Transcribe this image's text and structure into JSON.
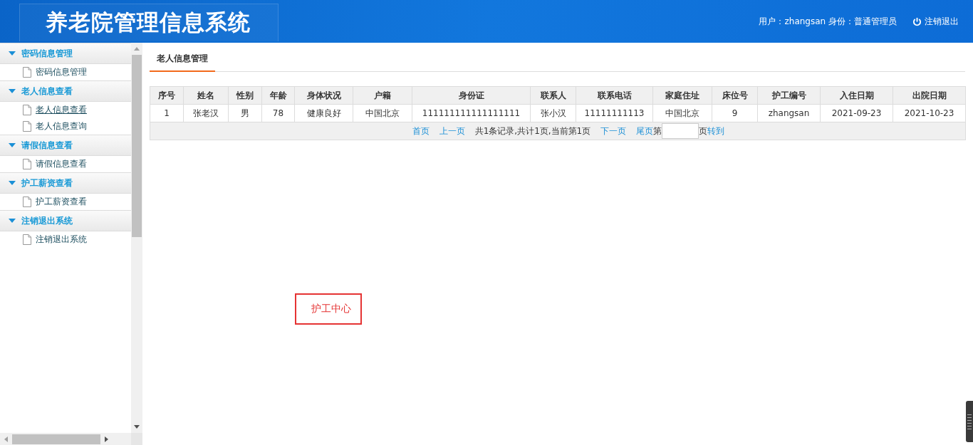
{
  "header": {
    "title": "养老院管理信息系统",
    "user_info": "用户：zhangsan 身份：普通管理员",
    "logout": "注销退出"
  },
  "sidebar": {
    "groups": [
      {
        "label": "密码信息管理",
        "expanded": true,
        "items": [
          {
            "label": "密码信息管理",
            "selected": false
          }
        ]
      },
      {
        "label": "老人信息查看",
        "expanded": true,
        "items": [
          {
            "label": "老人信息查看",
            "selected": true
          },
          {
            "label": "老人信息查询",
            "selected": false
          }
        ]
      },
      {
        "label": "请假信息查看",
        "expanded": true,
        "items": [
          {
            "label": "请假信息查看",
            "selected": false
          }
        ]
      },
      {
        "label": "护工薪资查看",
        "expanded": true,
        "items": [
          {
            "label": "护工薪资查看",
            "selected": false
          }
        ]
      },
      {
        "label": "注销退出系统",
        "expanded": true,
        "items": [
          {
            "label": "注销退出系统",
            "selected": false
          }
        ]
      }
    ]
  },
  "tab": {
    "label": "老人信息管理"
  },
  "table": {
    "columns": [
      "序号",
      "姓名",
      "性别",
      "年龄",
      "身体状况",
      "户籍",
      "身份证",
      "联系人",
      "联系电话",
      "家庭住址",
      "床位号",
      "护工编号",
      "入住日期",
      "出院日期"
    ],
    "rows": [
      [
        "1",
        "张老汉",
        "男",
        "78",
        "健康良好",
        "中国北京",
        "111111111111111111",
        "张小汉",
        "11111111113",
        "中国北京",
        "9",
        "zhangsan",
        "2021-09-23",
        "2021-10-23"
      ]
    ]
  },
  "pagination": {
    "first": "首页",
    "prev": "上一页",
    "summary": "共1条记录,共计1页,当前第1页",
    "next": "下一页",
    "last": "尾页",
    "page_prefix": "第",
    "page_suffix": "页",
    "go": "转到"
  },
  "floating_label": "护工中心"
}
